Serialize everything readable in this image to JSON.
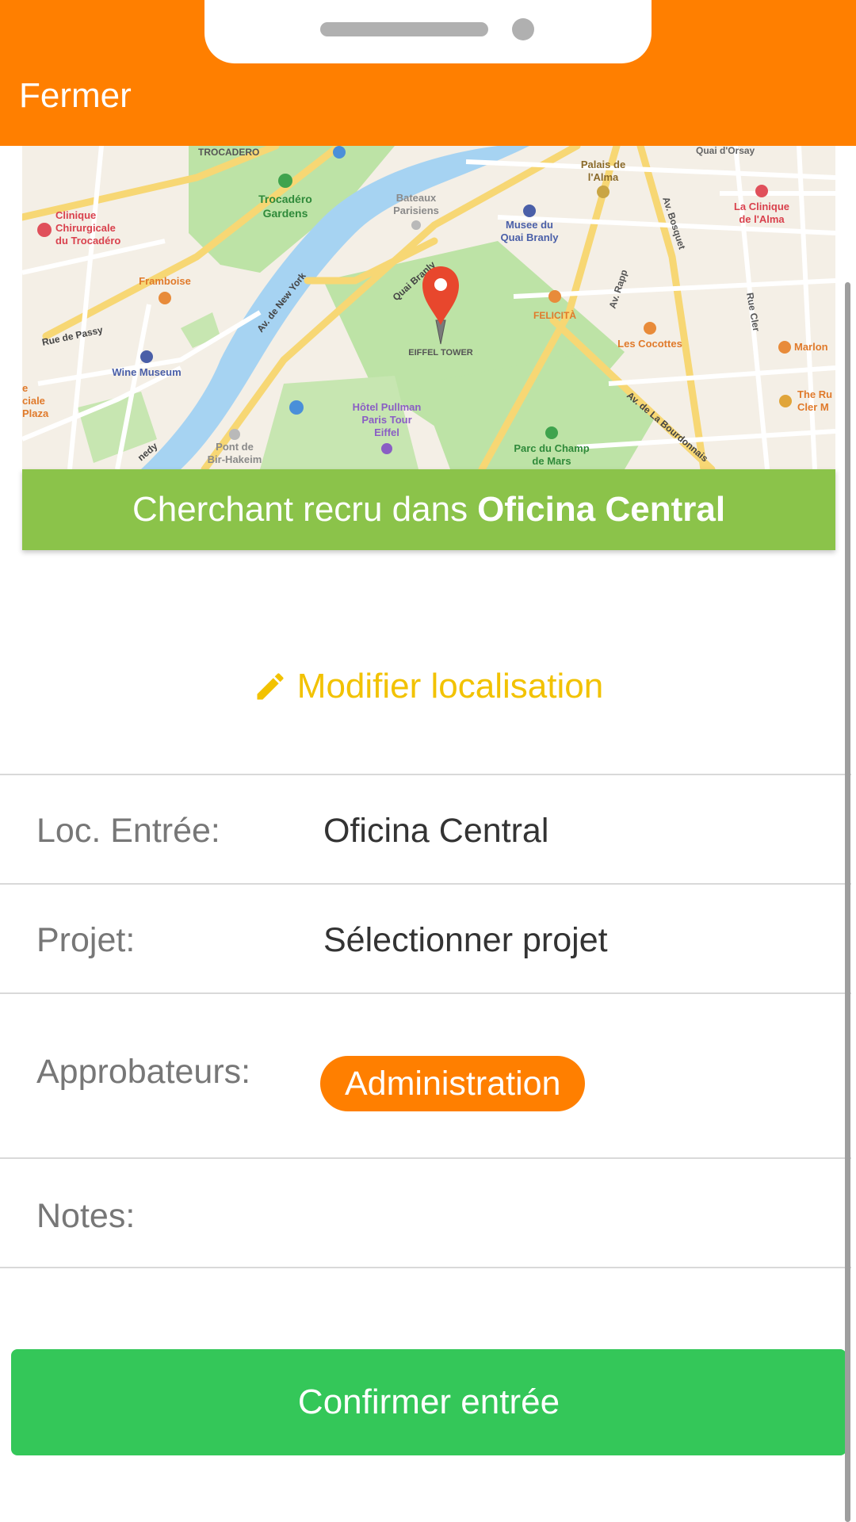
{
  "header": {
    "close_label": "Fermer",
    "color": "#ff7f00"
  },
  "map": {
    "pin_color": "#e8472d",
    "labels": {
      "trocadero": "TROCADERO",
      "trocadero_gardens_1": "Trocadéro",
      "trocadero_gardens_2": "Gardens",
      "bateaux_1": "Bateaux",
      "bateaux_2": "Parisiens",
      "palais_1": "Palais de",
      "palais_2": "l'Alma",
      "quai_orsay": "Quai d'Orsay",
      "clinique_alma_1": "La Clinique",
      "clinique_alma_2": "de l'Alma",
      "clinique_troc_1": "Clinique",
      "clinique_troc_2": "Chirurgicale",
      "clinique_troc_3": "du Trocadéro",
      "musee_1": "Musee du",
      "musee_2": "Quai Branly",
      "bosquet": "Av. Bosquet",
      "av_new_york": "Av. de New York",
      "quai_branly": "Quai Branly",
      "framboise": "Framboise",
      "felicita": "FELICITÀ",
      "av_rapp": "Av. Rapp",
      "rue_cler": "Rue Cler",
      "rue_passy": "Rue de Passy",
      "eiffel": "EIFFEL TOWER",
      "les_cocottes": "Les Cocottes",
      "marlon": "Marlon",
      "wine_museum": "Wine Museum",
      "ciale_1": "e",
      "ciale_2": "ciale",
      "ciale_3": "Plaza",
      "the_ru_1": "The Ru",
      "the_ru_2": "Cler M",
      "pullman_1": "Hôtel Pullman",
      "pullman_2": "Paris Tour",
      "pullman_3": "Eiffel",
      "bourdonnais": "Av. de La Bourdonnais",
      "bir_hakeim_1": "Pont de",
      "bir_hakeim_2": "Bir-Hakeim",
      "champ_mars_1": "Parc du Champ",
      "champ_mars_2": "de Mars",
      "kennedy": "nedy"
    }
  },
  "banner": {
    "prefix": "Cherchant recru dans",
    "location": "Oficina Central",
    "color": "#8bc34a"
  },
  "modify": {
    "label": "Modifier localisation",
    "icon": "pencil-icon",
    "color": "#f2c200"
  },
  "form": {
    "location_label": "Loc. Entrée:",
    "location_value": "Oficina Central",
    "project_label": "Projet:",
    "project_value": "Sélectionner projet",
    "approvers_label": "Approbateurs:",
    "approvers_tag": "Administration",
    "notes_label": "Notes:"
  },
  "confirm": {
    "label": "Confirmer entrée",
    "color": "#34c759"
  }
}
